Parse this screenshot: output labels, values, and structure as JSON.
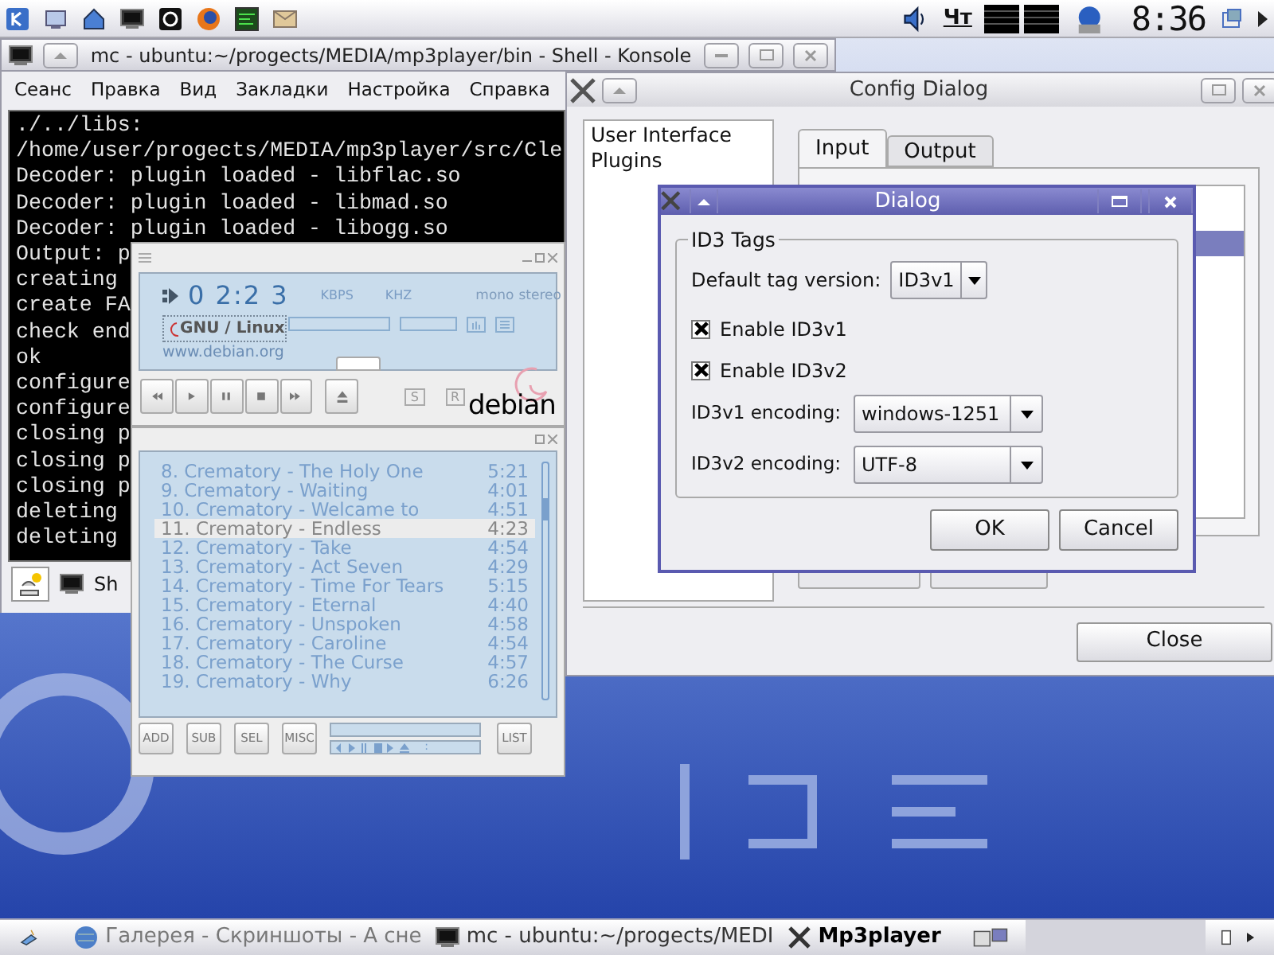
{
  "top_panel": {
    "indicator": "Чт",
    "clock": "8:36"
  },
  "konsole": {
    "title": "mc - ubuntu:~/progects/MEDIA/mp3player/bin - Shell - Konsole",
    "menu": [
      "Сеанс",
      "Правка",
      "Вид",
      "Закладки",
      "Настройка",
      "Справка"
    ],
    "lines": [
      "./../libs:",
      "/home/user/progects/MEDIA/mp3player/src/Cle",
      "Decoder: plugin loaded - libflac.so",
      "Decoder: plugin loaded - libmad.so",
      "Decoder: plugin loaded - libogg.so",
      "Output: p",
      "creating",
      "create FA",
      "check end",
      "ok",
      "configure",
      "configure",
      "closing p",
      "closing p",
      "closing p",
      "deleting",
      "deleting"
    ],
    "tab": "Sh"
  },
  "player": {
    "time": "0 2:2 3",
    "distro": "GNU / Linux",
    "url": "www.debian.org",
    "kbps_label": "KBPS",
    "khz_label": "KHZ",
    "mono": "mono",
    "stereo": "stereo",
    "shuffle": "S",
    "repeat": "R",
    "logo": "debian",
    "playlist": [
      {
        "title": "8. Crematory - The Holy One",
        "duration": "5:21",
        "selected": false
      },
      {
        "title": "9. Crematory - Waiting",
        "duration": "4:01",
        "selected": false
      },
      {
        "title": "10. Crematory - Welcame to",
        "duration": "4:51",
        "selected": false
      },
      {
        "title": "11. Crematory - Endless",
        "duration": "4:23",
        "selected": true
      },
      {
        "title": "12. Crematory - Take",
        "duration": "4:54",
        "selected": false
      },
      {
        "title": "13. Crematory - Act Seven",
        "duration": "4:29",
        "selected": false
      },
      {
        "title": "14. Crematory - Time For Tears",
        "duration": "5:15",
        "selected": false
      },
      {
        "title": "15. Crematory - Eternal",
        "duration": "4:40",
        "selected": false
      },
      {
        "title": "16. Crematory - Unspoken",
        "duration": "4:58",
        "selected": false
      },
      {
        "title": "17. Crematory - Caroline",
        "duration": "4:54",
        "selected": false
      },
      {
        "title": "18. Crematory - The Curse",
        "duration": "4:57",
        "selected": false
      },
      {
        "title": "19. Crematory - Why",
        "duration": "6:26",
        "selected": false
      }
    ],
    "playlist_buttons": [
      "ADD",
      "SUB",
      "SEL",
      "MISC"
    ],
    "list_button": "LIST",
    "mini_time": ":"
  },
  "config_dialog": {
    "title": "Config Dialog",
    "categories": [
      "User Interface",
      "Plugins"
    ],
    "tabs": [
      {
        "label": "Input",
        "selected": true
      },
      {
        "label": "Output",
        "selected": false
      }
    ],
    "close_button": "Close"
  },
  "dialog": {
    "title": "Dialog",
    "group": "ID3 Tags",
    "default_tag": {
      "label": "Default tag version:",
      "value": "ID3v1"
    },
    "checkboxes": [
      {
        "label": "Enable ID3v1",
        "checked": true
      },
      {
        "label": "Enable ID3v2",
        "checked": true
      }
    ],
    "encodings": [
      {
        "label": "ID3v1 encoding:",
        "value": "windows-1251"
      },
      {
        "label": "ID3v2 encoding:",
        "value": "UTF-8"
      }
    ],
    "buttons": [
      "OK",
      "Cancel"
    ]
  },
  "taskbar": {
    "items": [
      {
        "label": "Галерея - Скриншоты - А сне",
        "kind": "globe",
        "selected": false
      },
      {
        "label": "mc - ubuntu:~/progects/MEDI",
        "kind": "terminal",
        "selected": false
      },
      {
        "label": "Mp3player",
        "kind": "x",
        "selected": true
      }
    ]
  }
}
